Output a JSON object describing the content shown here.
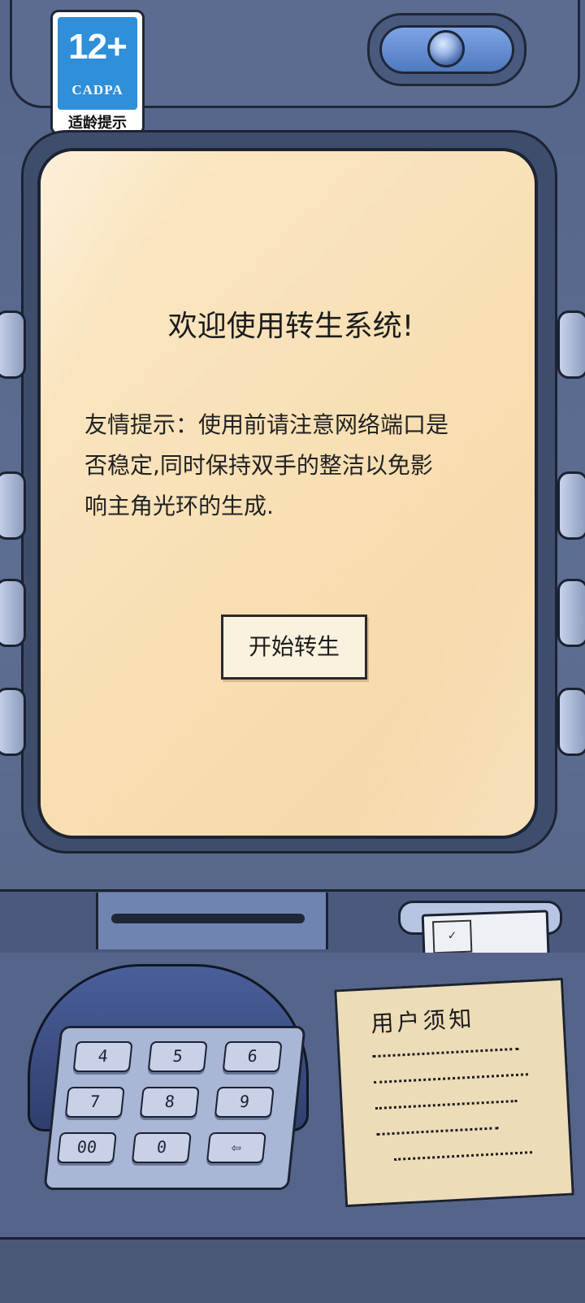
{
  "age_rating": {
    "age": "12+",
    "org": "CADPA",
    "hint": "适龄提示"
  },
  "screen": {
    "title": "欢迎使用转生系统!",
    "notice_lines": [
      "友情提示：使用前请注意网络端口是",
      "否稳定,同时保持双手的整洁以免影",
      "响主角光环的生成."
    ],
    "start_button": "开始转生"
  },
  "keypad": {
    "keys": [
      "4",
      "5",
      "6",
      "7",
      "8",
      "9",
      "00",
      "0",
      "⇦"
    ]
  },
  "notice_paper": {
    "title": "用户须知"
  },
  "colors": {
    "machine": "#5b6b8c",
    "screen": "#f8dfb3",
    "badge_blue": "#2f8fd8"
  }
}
